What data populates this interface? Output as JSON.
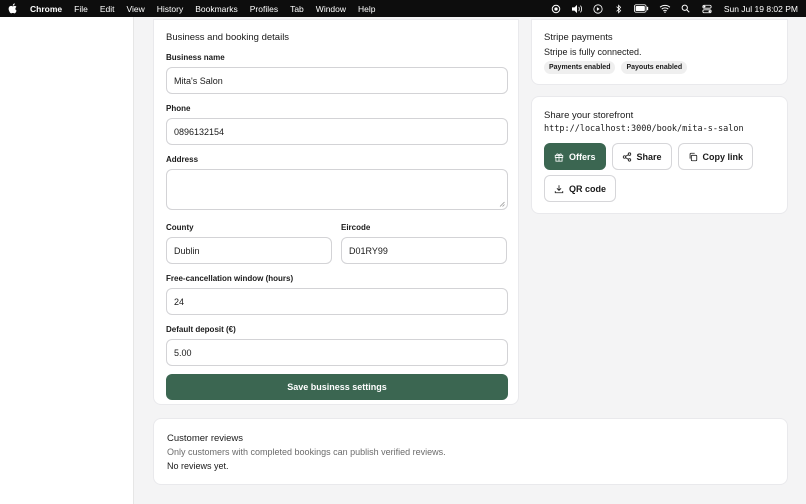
{
  "menubar": {
    "app": "Chrome",
    "items": [
      "File",
      "Edit",
      "View",
      "History",
      "Bookmarks",
      "Profiles",
      "Tab",
      "Window",
      "Help"
    ],
    "clock": "Sun Jul 19  8:02 PM"
  },
  "business": {
    "title": "Business and booking details",
    "name_label": "Business name",
    "name_value": "Mita's Salon",
    "phone_label": "Phone",
    "phone_value": "0896132154",
    "address_label": "Address",
    "address_value": "",
    "county_label": "County",
    "county_value": "Dublin",
    "eircode_label": "Eircode",
    "eircode_value": "D01RY99",
    "cancel_label": "Free-cancellation window (hours)",
    "cancel_value": "24",
    "deposit_label": "Default deposit (€)",
    "deposit_value": "5.00",
    "save_label": "Save business settings"
  },
  "stripe": {
    "title": "Stripe payments",
    "status": "Stripe is fully connected.",
    "badges": [
      "Payments enabled",
      "Payouts enabled"
    ]
  },
  "storefront": {
    "title": "Share your storefront",
    "url": "http://localhost:3000/book/mita-s-salon",
    "offers_label": "Offers",
    "share_label": "Share",
    "copy_label": "Copy link",
    "qr_label": "QR code"
  },
  "reviews": {
    "title": "Customer reviews",
    "subtitle": "Only customers with completed bookings can publish verified reviews.",
    "empty": "No reviews yet."
  },
  "colors": {
    "accent": "#3b6651",
    "menubar": "#0d0d0d"
  }
}
